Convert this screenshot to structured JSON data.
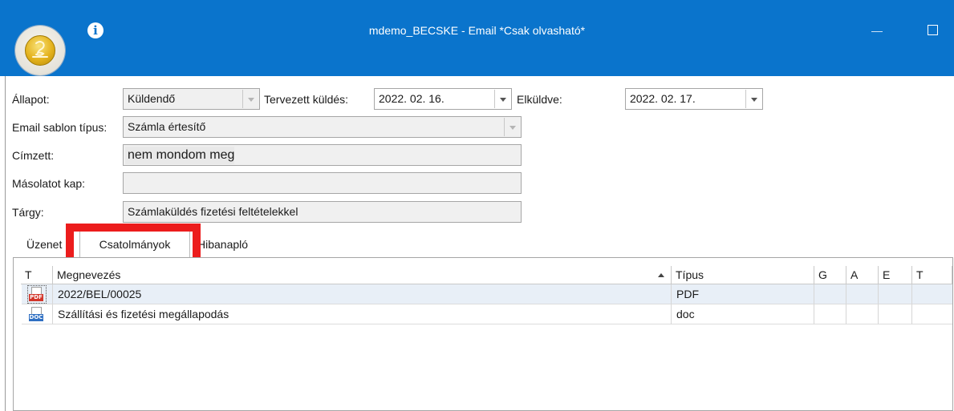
{
  "window": {
    "title": "mdemo_BECSKE - Email *Csak olvasható*"
  },
  "form": {
    "allapot_label": "Állapot:",
    "allapot_value": "Küldendő",
    "tervezett_label": "Tervezett küldés:",
    "tervezett_value": "2022. 02. 16.",
    "elkuldve_label": "Elküldve:",
    "elkuldve_value": "2022. 02. 17.",
    "sablon_label": "Email sablon típus:",
    "sablon_value": "Számla értesítő",
    "cimzett_label": "Címzett:",
    "cimzett_value": "nem mondom meg",
    "masolat_label": "Másolatot kap:",
    "masolat_value": "",
    "targy_label": "Tárgy:",
    "targy_value": "Számlaküldés fizetési feltételekkel"
  },
  "tabs": [
    {
      "label": "Üzenet",
      "active": false
    },
    {
      "label": "Csatolmányok",
      "active": true
    },
    {
      "label": "Hibanapló",
      "active": false
    }
  ],
  "grid": {
    "columns": [
      "T",
      "Megnevezés",
      "Típus",
      "G",
      "A",
      "E",
      "T"
    ],
    "rows": [
      {
        "icon": "pdf-file-icon",
        "name": "2022/BEL/00025",
        "type": "PDF",
        "selected": true
      },
      {
        "icon": "doc-file-icon",
        "name": "Szállítási és fizetési megállapodás",
        "type": "doc",
        "selected": false
      }
    ]
  },
  "icons": {
    "app": "app-logo-icon",
    "info": "info-icon",
    "minimize": "minimize-icon",
    "maximize": "maximize-icon"
  },
  "colors": {
    "titlebar": "#0a74cc",
    "highlight": "#ec1c1c",
    "selected_row": "#e8eff7"
  }
}
